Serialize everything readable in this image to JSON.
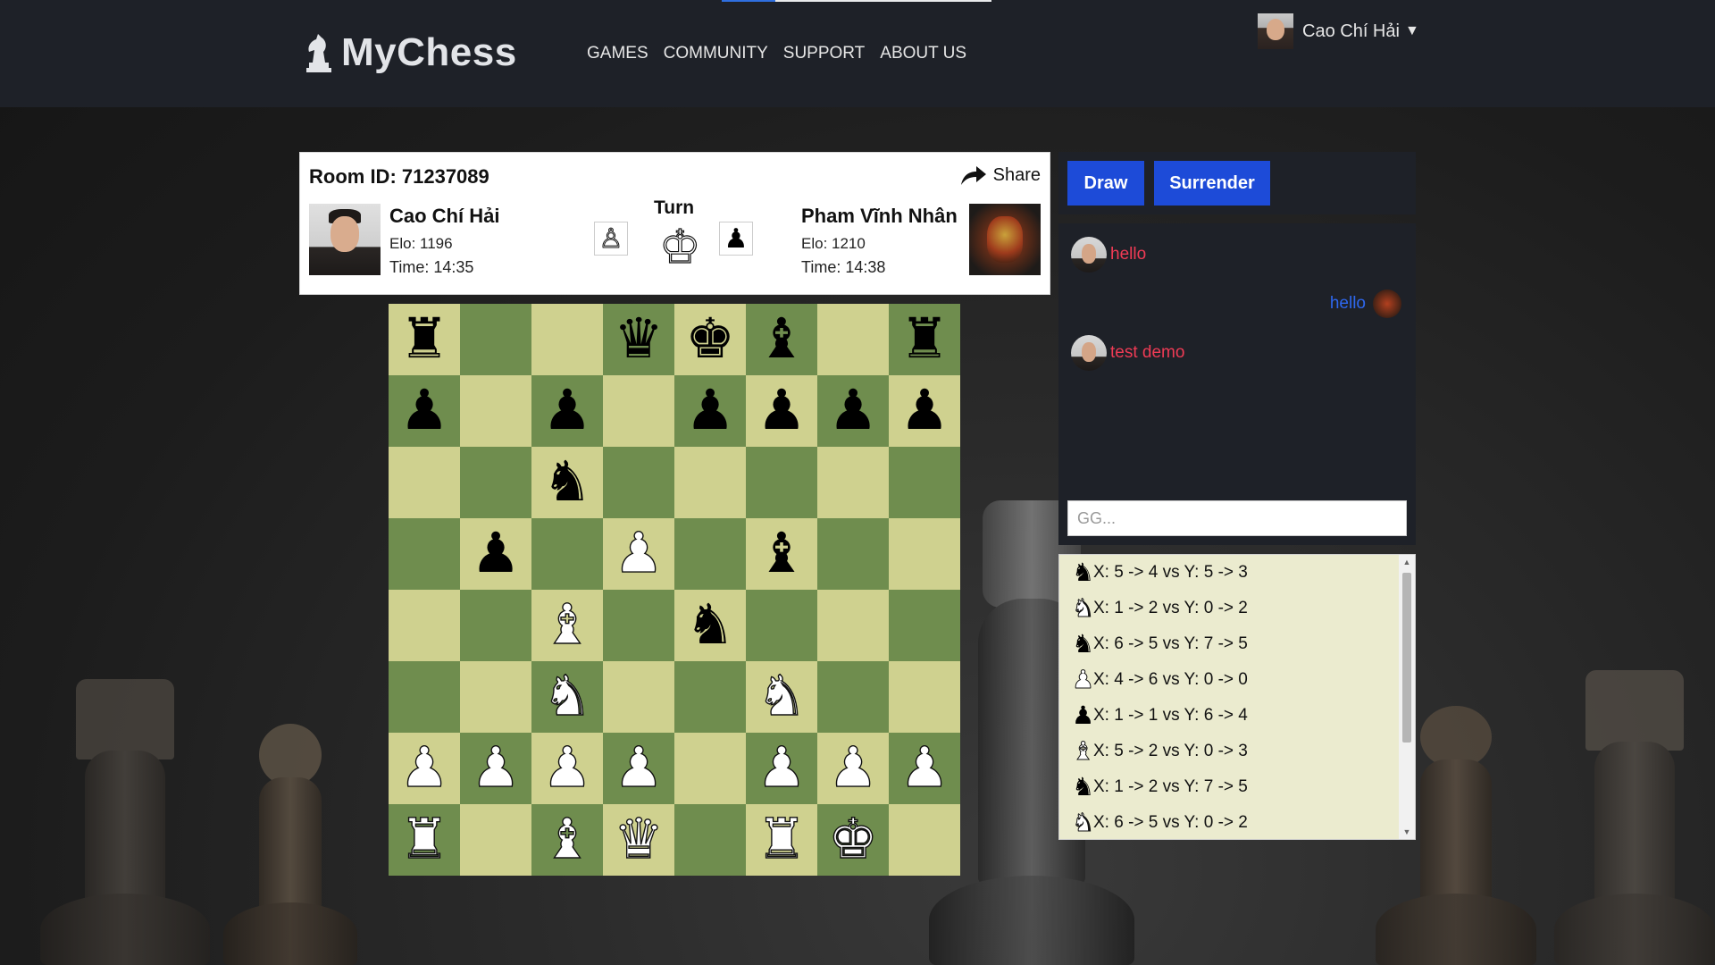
{
  "nav": {
    "brand": "MyChess",
    "links": [
      "GAMES",
      "COMMUNITY",
      "SUPPORT",
      "ABOUT US"
    ],
    "user_name": "Cao Chí Hải",
    "caret": "▼"
  },
  "game": {
    "room_id": "Room ID: 71237089",
    "share_label": "Share",
    "turn_label": "Turn",
    "turn_indicator": {
      "left": "♙",
      "main": "♔",
      "right": "♟"
    },
    "player1": {
      "name": "Cao Chí Hải",
      "elo": "Elo: 1196",
      "time": "Time: 14:35"
    },
    "player2": {
      "name": "Pham Vĩnh Nhân",
      "elo": "Elo: 1210",
      "time": "Time: 14:38"
    }
  },
  "board": [
    [
      "bR",
      "",
      "",
      "bQ",
      "bK",
      "bB",
      "",
      "bR"
    ],
    [
      "bP",
      "",
      "bP",
      "",
      "bP",
      "bP",
      "bP",
      "bP"
    ],
    [
      "",
      "",
      "bN",
      "",
      "",
      "",
      "",
      ""
    ],
    [
      "",
      "bP",
      "",
      "wP",
      "",
      "bB",
      "",
      ""
    ],
    [
      "",
      "",
      "wB",
      "",
      "bN",
      "",
      "",
      ""
    ],
    [
      "",
      "",
      "wN",
      "",
      "",
      "wN",
      "",
      ""
    ],
    [
      "wP",
      "wP",
      "wP",
      "wP",
      "",
      "wP",
      "wP",
      "wP"
    ],
    [
      "wR",
      "",
      "wB",
      "wQ",
      "",
      "wR",
      "wK",
      ""
    ]
  ],
  "piece_glyphs": {
    "K": "♚",
    "Q": "♛",
    "R": "♜",
    "B": "♝",
    "N": "♞",
    "P": "♟"
  },
  "board_colors": {
    "light": "#cfd18f",
    "dark": "#6f8d4e"
  },
  "actions": {
    "draw": "Draw",
    "surrender": "Surrender"
  },
  "chat": {
    "messages": [
      {
        "from": "me",
        "text": "hello"
      },
      {
        "from": "opponent",
        "text": "hello"
      },
      {
        "from": "me",
        "text": "test demo"
      }
    ],
    "input_placeholder": "GG..."
  },
  "moves": [
    {
      "piece": "knight",
      "color": "black",
      "text": "X: 5 -> 4 vs Y: 5 -> 3"
    },
    {
      "piece": "knight",
      "color": "white",
      "text": "X: 1 -> 2 vs Y: 0 -> 2"
    },
    {
      "piece": "knight",
      "color": "black",
      "text": "X: 6 -> 5 vs Y: 7 -> 5"
    },
    {
      "piece": "pawn",
      "color": "white",
      "text": "X: 4 -> 6 vs Y: 0 -> 0"
    },
    {
      "piece": "pawn",
      "color": "black",
      "text": "X: 1 -> 1 vs Y: 6 -> 4"
    },
    {
      "piece": "bishop",
      "color": "white",
      "text": "X: 5 -> 2 vs Y: 0 -> 3"
    },
    {
      "piece": "knight",
      "color": "black",
      "text": "X: 1 -> 2 vs Y: 7 -> 5"
    },
    {
      "piece": "knight",
      "color": "white",
      "text": "X: 6 -> 5 vs Y: 0 -> 2"
    }
  ],
  "colors": {
    "accent": "#1d4bd8",
    "chat_in": "#ef3b55",
    "chat_out": "#2e67ee",
    "navbar": "#1e2128"
  }
}
